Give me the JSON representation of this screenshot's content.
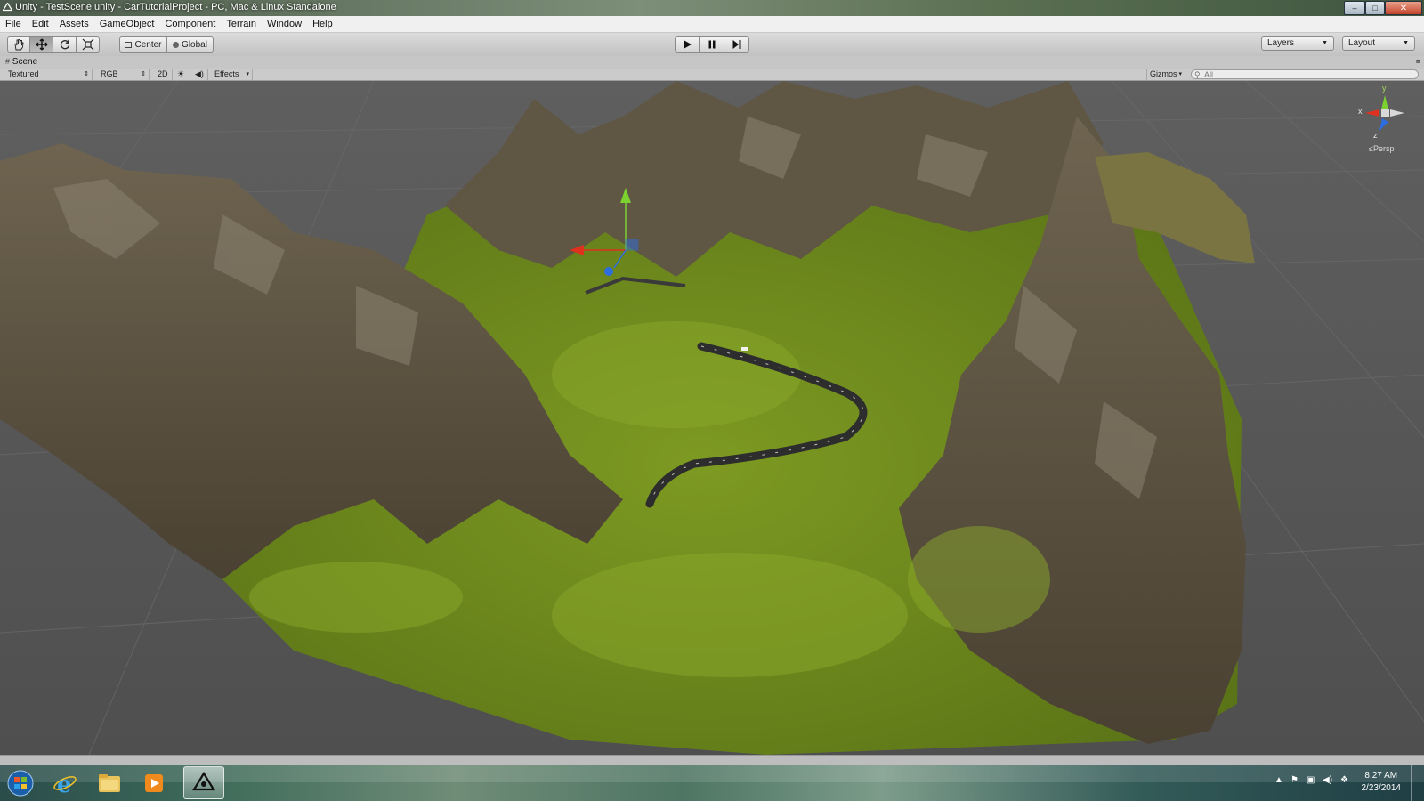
{
  "window": {
    "title": "Unity - TestScene.unity - CarTutorialProject - PC, Mac & Linux Standalone",
    "controls": {
      "minimize": "–",
      "maximize": "□",
      "close": "✕"
    }
  },
  "menu": [
    "File",
    "Edit",
    "Assets",
    "GameObject",
    "Component",
    "Terrain",
    "Window",
    "Help"
  ],
  "toolbar": {
    "tools": [
      "hand-icon",
      "move-icon",
      "rotate-icon",
      "scale-icon"
    ],
    "active_tool": "move-icon",
    "pivot_mode": "Center",
    "pivot_rotation": "Global",
    "play_controls": [
      "play-icon",
      "pause-icon",
      "step-icon"
    ],
    "layers": "Layers",
    "layout": "Layout"
  },
  "scene_tab": {
    "label": "Scene",
    "icon": "scene-grid-icon"
  },
  "scene_controls": {
    "draw_mode": "Textured",
    "render_mode": "RGB",
    "mode_2d": "2D",
    "lighting_icon": "sun-icon",
    "audio_icon": "speaker-icon",
    "effects": "Effects",
    "gizmos": "Gizmos",
    "search_placeholder": "All"
  },
  "orientation_gizmo": {
    "y_label": "y",
    "x_label": "x",
    "z_label": "z",
    "projection": "Persp"
  },
  "taskbar": {
    "items": [
      "start-orb-icon",
      "internet-explorer-icon",
      "file-explorer-icon",
      "media-player-icon",
      "unity-icon"
    ],
    "active_item": "unity-icon",
    "time": "8:27 AM",
    "date": "2/23/2014"
  },
  "colors": {
    "grass": "#6f8a1c",
    "rock": "#5a5140",
    "grid_background": "#5a5a5a",
    "road": "#303030",
    "axis_x": "#e0301e",
    "axis_y": "#7bd130",
    "axis_z": "#2e6de0"
  }
}
